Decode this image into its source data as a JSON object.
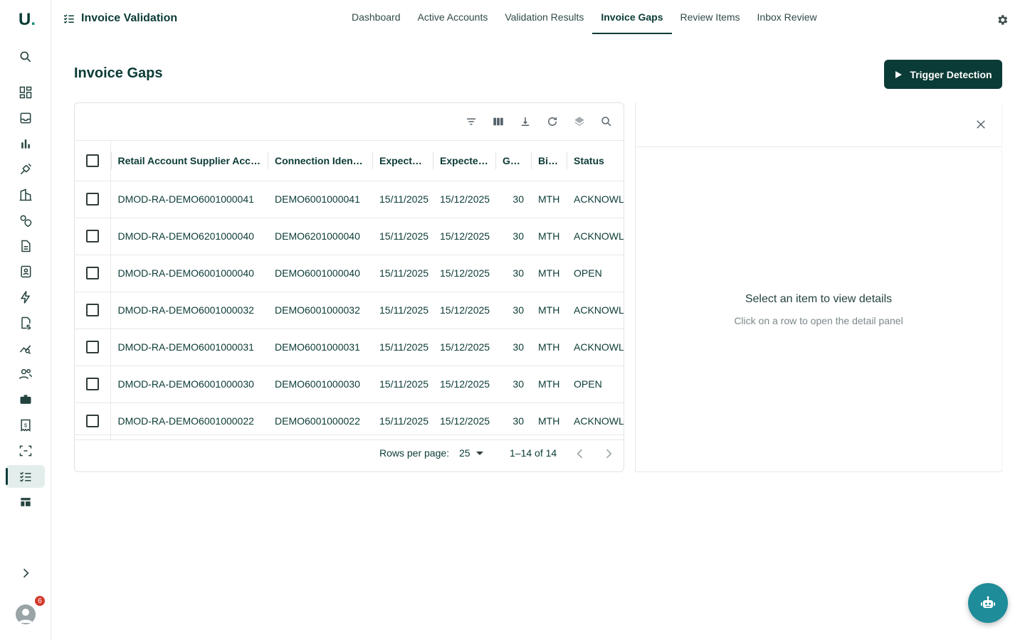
{
  "brand": {
    "logo_letter": "U",
    "logo_dot": "."
  },
  "app": {
    "title": "Invoice Validation"
  },
  "nav": {
    "tabs": [
      {
        "label": "Dashboard"
      },
      {
        "label": "Active Accounts"
      },
      {
        "label": "Validation Results"
      },
      {
        "label": "Invoice Gaps",
        "active": true
      },
      {
        "label": "Review Items"
      },
      {
        "label": "Inbox Review"
      }
    ]
  },
  "sidebar": {
    "icons": [
      "search-icon",
      "dashboard-icon",
      "inbox-icon",
      "bar-chart-icon",
      "satellite-icon",
      "building-icon",
      "location-icon",
      "document-icon",
      "contacts-icon",
      "bolt-icon",
      "invoice-icon",
      "trend-icon",
      "people-icon",
      "briefcase-icon",
      "receipt-icon",
      "scan-icon",
      "checklist-icon",
      "table-icon"
    ],
    "active": "checklist-icon",
    "notification_count": "6"
  },
  "page": {
    "title": "Invoice Gaps",
    "trigger_label": "Trigger Detection"
  },
  "table": {
    "columns": [
      "Retail Account Supplier Accoun...",
      "Connection Identifi...",
      "Expecte...",
      "Expected...",
      "Ga...",
      "Billi...",
      "Status"
    ],
    "rows": [
      [
        "DMOD-RA-DEMO6001000041",
        "DEMO6001000041",
        "15/11/2025",
        "15/12/2025",
        "30",
        "MTH",
        "ACKNOWL"
      ],
      [
        "DMOD-RA-DEMO6201000040",
        "DEMO6201000040",
        "15/11/2025",
        "15/12/2025",
        "30",
        "MTH",
        "ACKNOWL"
      ],
      [
        "DMOD-RA-DEMO6001000040",
        "DEMO6001000040",
        "15/11/2025",
        "15/12/2025",
        "30",
        "MTH",
        "OPEN"
      ],
      [
        "DMOD-RA-DEMO6001000032",
        "DEMO6001000032",
        "15/11/2025",
        "15/12/2025",
        "30",
        "MTH",
        "ACKNOWL"
      ],
      [
        "DMOD-RA-DEMO6001000031",
        "DEMO6001000031",
        "15/11/2025",
        "15/12/2025",
        "30",
        "MTH",
        "ACKNOWL"
      ],
      [
        "DMOD-RA-DEMO6001000030",
        "DEMO6001000030",
        "15/11/2025",
        "15/12/2025",
        "30",
        "MTH",
        "OPEN"
      ],
      [
        "DMOD-RA-DEMO6001000022",
        "DEMO6001000022",
        "15/11/2025",
        "15/12/2025",
        "30",
        "MTH",
        "ACKNOWL"
      ]
    ],
    "footer": {
      "rows_per_page_label": "Rows per page:",
      "rows_per_page_value": "25",
      "range": "1–14 of 14"
    }
  },
  "detail": {
    "empty_title": "Select an item to view details",
    "empty_subtitle": "Click on a row to open the detail panel"
  },
  "colors": {
    "primary": "#0b3b36",
    "accent": "#1f8c7a",
    "fab": "#1f8c9a",
    "badge": "#d33a2c"
  }
}
